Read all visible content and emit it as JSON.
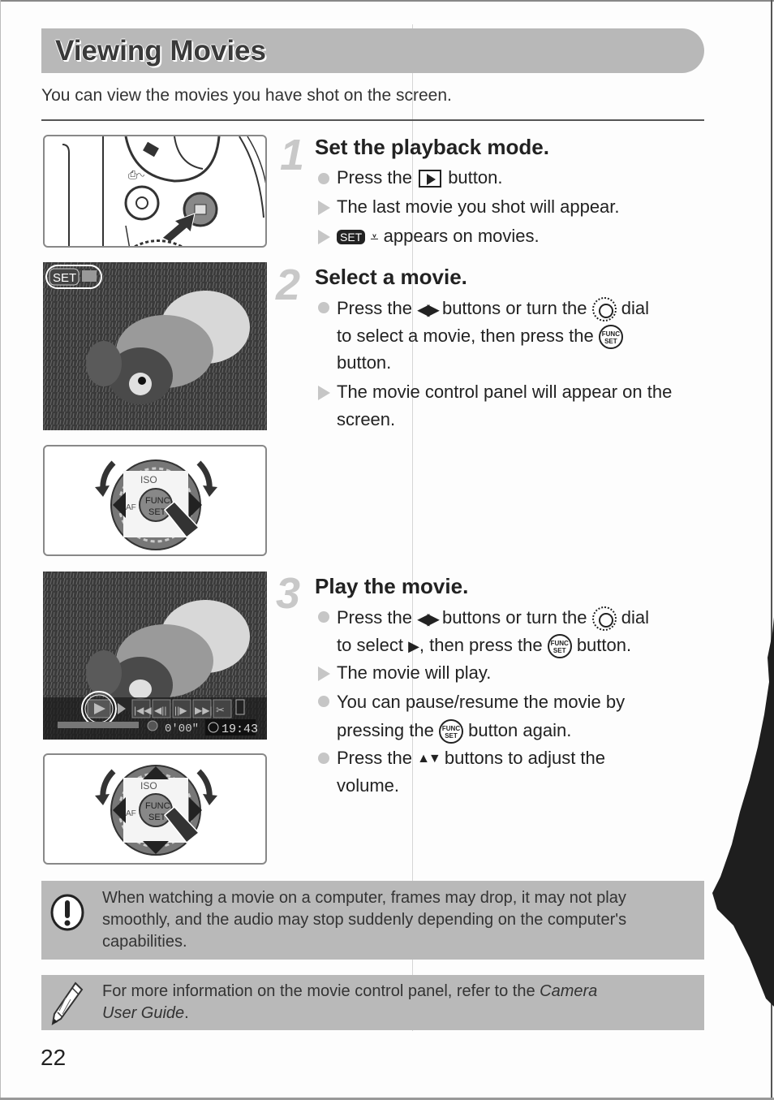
{
  "page": {
    "title": "Viewing Movies",
    "intro": "You can view the movies you have shot on the screen.",
    "page_number": "22"
  },
  "steps": [
    {
      "number": "1",
      "title": "Set the playback mode.",
      "lines": [
        {
          "type": "bullet",
          "before": "Press the",
          "icon": "playback-button-icon",
          "after": "button."
        },
        {
          "type": "result",
          "text": "The last movie you shot will appear."
        },
        {
          "type": "result",
          "icon_label": "SET",
          "icon2": "movie-icon",
          "after": "appears on movies."
        }
      ]
    },
    {
      "number": "2",
      "title": "Select a movie.",
      "lines": [
        {
          "type": "bullet",
          "before": "Press the",
          "icon": "left-right-buttons-icon",
          "middle": "buttons or turn the",
          "icon2": "control-dial-icon",
          "after": "dial"
        },
        {
          "type": "cont",
          "before": "to select a movie, then press the",
          "icon": "func-set-button-icon"
        },
        {
          "type": "cont",
          "text": "button."
        },
        {
          "type": "result",
          "text": "The movie control panel will appear on the"
        },
        {
          "type": "cont",
          "text": "screen."
        }
      ]
    },
    {
      "number": "3",
      "title": "Play the movie.",
      "lines": [
        {
          "type": "bullet",
          "before": "Press the",
          "icon": "left-right-buttons-icon",
          "middle": "buttons or turn the",
          "icon2": "control-dial-icon",
          "after": "dial"
        },
        {
          "type": "cont",
          "before": "to select",
          "icon": "play-triangle-icon",
          "middle": ", then press the",
          "icon2": "func-set-button-icon",
          "after": "button."
        },
        {
          "type": "result",
          "text": "The movie will play."
        },
        {
          "type": "bullet",
          "text": "You can pause/resume the movie by"
        },
        {
          "type": "cont",
          "before": "pressing the",
          "icon": "func-set-button-icon",
          "after": "button again."
        },
        {
          "type": "bullet",
          "before": "Press the",
          "icon": "up-down-buttons-icon",
          "after": "buttons to adjust the"
        },
        {
          "type": "cont",
          "text": "volume."
        }
      ]
    }
  ],
  "icons": {
    "set_label": "SET",
    "func_label_1": "FUNC",
    "func_label_2": "SET",
    "left_right": "◀▶",
    "up_down": "▲▼",
    "play": "▶"
  },
  "figures": {
    "screen1_overlay": "SET",
    "dial_labels": {
      "iso": "ISO",
      "func": "FUNC.",
      "set": "SET",
      "af": "AF"
    },
    "player": {
      "elapsed": "0'00\"",
      "time": "19:43"
    }
  },
  "notes": {
    "caution": {
      "icon": "caution-icon",
      "lines": [
        "When watching a movie on a computer, frames may drop, it may not play",
        "smoothly, and the audio may stop suddenly depending on the computer's",
        "capabilities."
      ]
    },
    "tip": {
      "icon": "pencil-icon",
      "line1_plain": "For more information on the movie control panel, refer to the ",
      "line1_italic": "Camera",
      "line2_italic": "User Guide",
      "line2_plain": "."
    }
  },
  "colors": {
    "title_bar": "#b8b8b8",
    "note_bg": "#b9b9b9",
    "step_number": "#c8c8c8",
    "text": "#222222"
  }
}
